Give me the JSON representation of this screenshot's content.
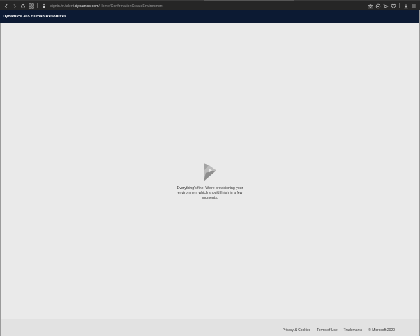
{
  "browser": {
    "url_prefix": "signin.hr.talent.",
    "url_domain": "dynamics.com",
    "url_path": "/Home/ConfirmationCreateEnvironment",
    "nav_icons": [
      "back-icon",
      "forward-icon",
      "reload-icon",
      "apps-icon"
    ],
    "right_icons": [
      "camera-icon",
      "shield-icon",
      "send-icon",
      "heart-icon",
      "download-icon",
      "menu-icon"
    ]
  },
  "app": {
    "title": "Dynamics 365 Human Resources"
  },
  "main": {
    "logo": "dynamics-logo-icon",
    "message": "Everything's fine. We're provisioning your environment which should finish in a few moments."
  },
  "footer": {
    "links": [
      "Privacy & Cookies",
      "Terms of Use",
      "Trademarks",
      "© Microsoft 2020"
    ]
  },
  "colors": {
    "header_bg": "#0c1a33",
    "main_bg": "#eaeaea",
    "toolbar_bg": "#262626"
  }
}
